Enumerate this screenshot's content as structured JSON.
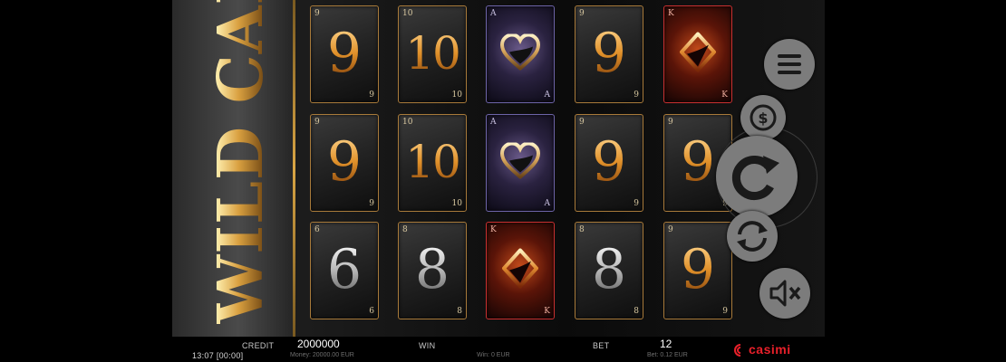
{
  "title": "WILD CARD",
  "reels": [
    [
      {
        "kind": "rank",
        "rank": "9",
        "corner": "9",
        "tone": "gold"
      },
      {
        "kind": "rank",
        "rank": "9",
        "corner": "9",
        "tone": "gold"
      },
      {
        "kind": "rank",
        "rank": "6",
        "corner": "6",
        "tone": "silver"
      }
    ],
    [
      {
        "kind": "rank",
        "rank": "10",
        "corner": "10",
        "tone": "gold"
      },
      {
        "kind": "rank",
        "rank": "10",
        "corner": "10",
        "tone": "gold"
      },
      {
        "kind": "rank",
        "rank": "8",
        "corner": "8",
        "tone": "silver"
      }
    ],
    [
      {
        "kind": "heart",
        "corner": "A"
      },
      {
        "kind": "heart",
        "corner": "A"
      },
      {
        "kind": "diamond",
        "corner": "K"
      }
    ],
    [
      {
        "kind": "rank",
        "rank": "9",
        "corner": "9",
        "tone": "gold"
      },
      {
        "kind": "rank",
        "rank": "9",
        "corner": "9",
        "tone": "gold"
      },
      {
        "kind": "rank",
        "rank": "8",
        "corner": "8",
        "tone": "silver"
      }
    ],
    [
      {
        "kind": "diamond",
        "corner": "K"
      },
      {
        "kind": "rank",
        "rank": "9",
        "corner": "9",
        "tone": "gold"
      },
      {
        "kind": "rank",
        "rank": "9",
        "corner": "9",
        "tone": "gold"
      }
    ]
  ],
  "controls": [
    {
      "name": "menu-button",
      "icon": "hamburger-icon"
    },
    {
      "name": "bet-button",
      "icon": "coin-dollar-icon"
    },
    {
      "name": "spin-button",
      "icon": "spin-arrow-icon"
    },
    {
      "name": "autoplay-button",
      "icon": "autoplay-arrows-icon"
    },
    {
      "name": "sound-button",
      "icon": "speaker-muted-icon"
    }
  ],
  "status": {
    "credit_label": "CREDIT",
    "credit_value": "2000000",
    "money": "Money: 20000.00 EUR",
    "win_label": "WIN",
    "win_sub": "Win: 0 EUR",
    "bet_label": "BET",
    "bet_value": "12",
    "bet_sub": "Bet: 0.12 EUR",
    "clock": "13:07 [00:00]",
    "brand": "casimi"
  },
  "colors": {
    "gold": "#d9a040",
    "brand_red": "#e8202a",
    "control_grey": "#7c7c7c"
  }
}
